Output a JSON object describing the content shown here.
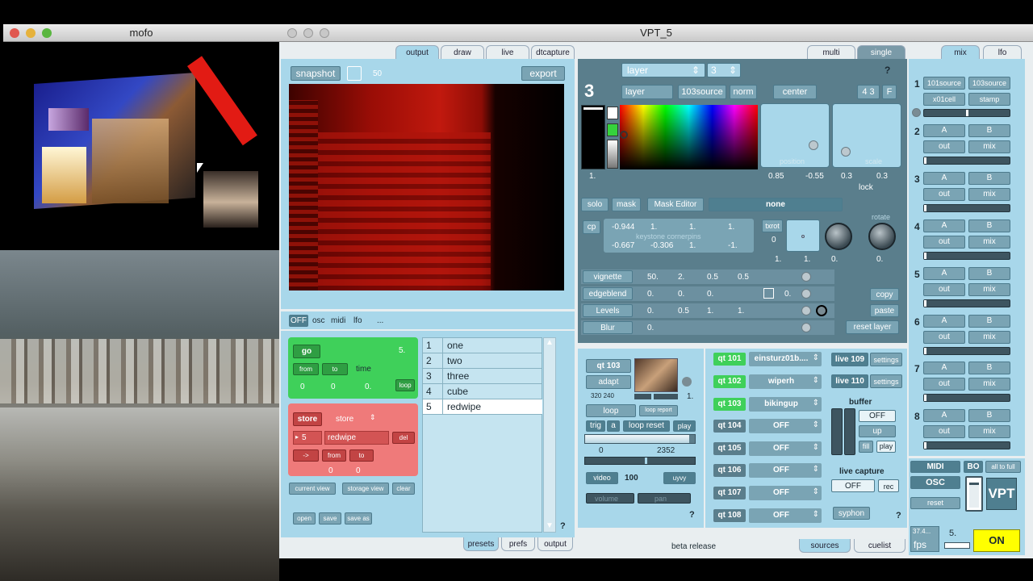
{
  "mofo_window": {
    "title": "mofo"
  },
  "main_window": {
    "title": "VPT_5"
  },
  "output_tabs": [
    "output",
    "draw",
    "live",
    "dtcapture"
  ],
  "preview": {
    "snapshot_label": "snapshot",
    "snapshot_value": "50",
    "export_label": "export"
  },
  "control_row": {
    "items": [
      "OFF",
      "osc",
      "midi",
      "lfo",
      "..."
    ]
  },
  "go_panel": {
    "go_label": "go",
    "value": "5.",
    "from_label": "from",
    "to_label": "to",
    "time_label": "time",
    "vals": [
      "0",
      "0",
      "0."
    ],
    "loop_label": "loop"
  },
  "store_panel": {
    "store_label": "store",
    "store_select": "store",
    "arrow": "▸",
    "slot": "5",
    "name": "redwipe",
    "del_label": "del",
    "arrow_btn": "->",
    "from_label": "from",
    "to_label": "to",
    "vals": [
      "0",
      "0"
    ]
  },
  "view_buttons": [
    "current view",
    "storage view",
    "clear"
  ],
  "file_buttons": [
    "open",
    "save",
    "save as"
  ],
  "presets": [
    {
      "n": "1",
      "name": "one"
    },
    {
      "n": "2",
      "name": "two"
    },
    {
      "n": "3",
      "name": "three"
    },
    {
      "n": "4",
      "name": "cube"
    },
    {
      "n": "5",
      "name": "redwipe"
    }
  ],
  "help_mark": "?",
  "bottom_tabs": [
    "presets",
    "prefs",
    "output"
  ],
  "layer_tabs": [
    "multi",
    "single"
  ],
  "layer": {
    "select_label": "layer",
    "select_num": "3",
    "big_num": "3",
    "layer_field": "layer",
    "source": "103source",
    "blend": "norm",
    "center": "center",
    "ratio": "4 3",
    "f": "F",
    "alpha": "1.",
    "position_label": "position",
    "scale_label": "scale",
    "pos_x": "0.85",
    "pos_y": "-0.55",
    "scale_x": "0.3",
    "scale_y": "0.3",
    "lock": "lock",
    "solo": "solo",
    "mask": "mask",
    "mask_editor": "Mask Editor",
    "mask_value": "none",
    "cp": "cp",
    "corners_label": "keystone cornerpins",
    "corners_row1": [
      "-0.944",
      "1.",
      "1.",
      "1."
    ],
    "corners_row2": [
      "-0.667",
      "-0.306",
      "1.",
      "-1."
    ],
    "txrot": "txrot",
    "txrot_val": "0",
    "rotate_label": "rotate",
    "pad_vals": [
      "1.",
      "1.",
      "0.",
      "0."
    ],
    "fx": [
      {
        "name": "vignette",
        "vals": [
          "50.",
          "2.",
          "0.5",
          "0.5"
        ]
      },
      {
        "name": "edgeblend",
        "vals": [
          "0.",
          "0.",
          "0.",
          "0."
        ]
      },
      {
        "name": "Levels",
        "vals": [
          "0.",
          "0.5",
          "1.",
          "1."
        ]
      },
      {
        "name": "Blur",
        "vals": [
          "0."
        ]
      }
    ],
    "copy": "copy",
    "paste": "paste",
    "reset": "reset layer"
  },
  "qt_player": {
    "name": "qt 103",
    "adapt": "adapt",
    "size": "320 240",
    "rate": "1.",
    "loop": "loop",
    "loop_report": "loop report",
    "trig": "trig",
    "a": "a",
    "loop_reset": "loop reset",
    "play": "play",
    "range_start": "0",
    "range_end": "2352",
    "video": "video",
    "volume_val": "100",
    "uyvy": "uyvy",
    "volume": "volume",
    "pan": "pan",
    "help": "?",
    "playhead": 0.42,
    "position": 0.95,
    "slider": 0.55
  },
  "sources": [
    {
      "id": "qt 101",
      "name": "einsturz01b....",
      "active": true
    },
    {
      "id": "qt 102",
      "name": "wiperh",
      "active": true
    },
    {
      "id": "qt 103",
      "name": "bikingup",
      "active": true
    },
    {
      "id": "qt 104",
      "name": "OFF",
      "active": false
    },
    {
      "id": "qt 105",
      "name": "OFF",
      "active": false
    },
    {
      "id": "qt 106",
      "name": "OFF",
      "active": false
    },
    {
      "id": "qt 107",
      "name": "OFF",
      "active": false
    },
    {
      "id": "qt 108",
      "name": "OFF",
      "active": false
    }
  ],
  "live": [
    {
      "id": "live 109",
      "settings": "settings"
    },
    {
      "id": "live 110",
      "settings": "settings"
    }
  ],
  "buffer": {
    "title": "buffer",
    "off": "OFF",
    "up": "up",
    "fill": "fill",
    "play": "play"
  },
  "live_capture": {
    "title": "live capture",
    "off": "OFF",
    "rec": "rec",
    "syphon": "syphon",
    "help": "?"
  },
  "status_bar": {
    "text": "beta release"
  },
  "right_bottom_tabs": [
    "sources",
    "cuelist"
  ],
  "mix_tabs": [
    "mix",
    "lfo"
  ],
  "mix_rows": [
    {
      "n": "1",
      "a": "101source",
      "b": "103source",
      "out": "x01cell",
      "mix": "stamp",
      "level": 0.5
    },
    {
      "n": "2",
      "a": "A",
      "b": "B",
      "out": "out",
      "mix": "mix",
      "level": 0
    },
    {
      "n": "3",
      "a": "A",
      "b": "B",
      "out": "out",
      "mix": "mix",
      "level": 0
    },
    {
      "n": "4",
      "a": "A",
      "b": "B",
      "out": "out",
      "mix": "mix",
      "level": 0
    },
    {
      "n": "5",
      "a": "A",
      "b": "B",
      "out": "out",
      "mix": "mix",
      "level": 0
    },
    {
      "n": "6",
      "a": "A",
      "b": "B",
      "out": "out",
      "mix": "mix",
      "level": 0
    },
    {
      "n": "7",
      "a": "A",
      "b": "B",
      "out": "out",
      "mix": "mix",
      "level": 0
    },
    {
      "n": "8",
      "a": "A",
      "b": "B",
      "out": "out",
      "mix": "mix",
      "level": 0
    }
  ],
  "global": {
    "midi": "MIDI",
    "bo": "BO",
    "all_to_full": "all to full",
    "osc": "OSC",
    "reset": "reset",
    "logo": "VPT",
    "fps_val": "37.4...",
    "fps": "fps",
    "five": "5.",
    "on": "ON",
    "master_level": 0.9
  }
}
